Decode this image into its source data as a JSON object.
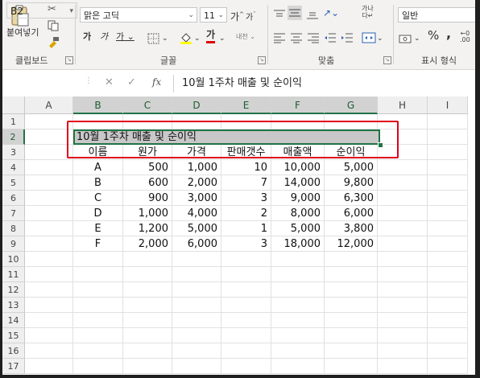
{
  "ribbon": {
    "clipboard": {
      "paste_label": "붙여넣기",
      "group_label": "클립보드"
    },
    "font": {
      "font_name": "맑은 고딕",
      "font_size": "11",
      "bold": "가",
      "italic": "가",
      "underline": "가",
      "fill_color": "#FFFF00",
      "font_color": "#E00000",
      "group_label": "글꼴"
    },
    "alignment": {
      "group_label": "맞춤"
    },
    "number": {
      "format": "일반",
      "group_label": "표시 형식"
    }
  },
  "formula_bar": {
    "name_box": "B2",
    "fx": "fx",
    "content": "10월 1주차 매출 및 순이익"
  },
  "columns": [
    "A",
    "B",
    "C",
    "D",
    "E",
    "F",
    "G",
    "H",
    "I"
  ],
  "rows": [
    "1",
    "2",
    "3",
    "4",
    "5",
    "6",
    "7",
    "8",
    "9",
    "10",
    "11",
    "12",
    "13",
    "14",
    "15",
    "16",
    "17"
  ],
  "sheet": {
    "b2_title": "10월 1주차 매출 및 순이익",
    "headers": [
      "이름",
      "원가",
      "가격",
      "판매갯수",
      "매출액",
      "순이익"
    ],
    "data": [
      [
        "A",
        "500",
        "1,000",
        "10",
        "10,000",
        "5,000"
      ],
      [
        "B",
        "600",
        "2,000",
        "7",
        "14,000",
        "9,800"
      ],
      [
        "C",
        "900",
        "3,000",
        "3",
        "9,000",
        "6,300"
      ],
      [
        "D",
        "1,000",
        "4,000",
        "2",
        "8,000",
        "6,000"
      ],
      [
        "E",
        "1,200",
        "5,000",
        "1",
        "5,000",
        "3,800"
      ],
      [
        "F",
        "2,000",
        "6,000",
        "3",
        "18,000",
        "12,000"
      ]
    ]
  },
  "accent": "#217346",
  "highlight": "#E0001B"
}
